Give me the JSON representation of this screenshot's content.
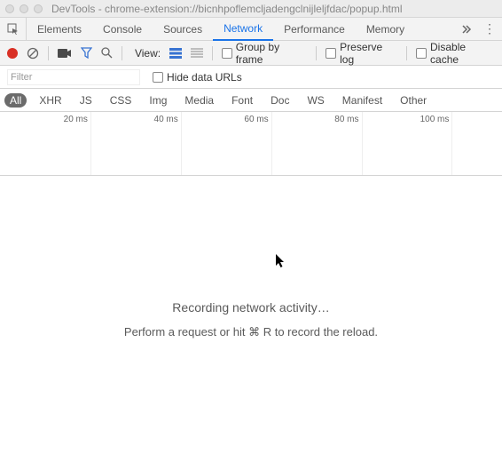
{
  "window": {
    "title": "DevTools - chrome-extension://bicnhpoflemcljadengclnijleljfdac/popup.html"
  },
  "tabs": {
    "items": [
      {
        "label": "Elements"
      },
      {
        "label": "Console"
      },
      {
        "label": "Sources"
      },
      {
        "label": "Network"
      },
      {
        "label": "Performance"
      },
      {
        "label": "Memory"
      }
    ],
    "active_index": 3
  },
  "toolbar": {
    "view_label": "View:",
    "group_by_frame": "Group by frame",
    "preserve_log": "Preserve log",
    "disable_cache": "Disable cache"
  },
  "filterbar": {
    "placeholder": "Filter",
    "hide_data_urls": "Hide data URLs"
  },
  "types": {
    "items": [
      "All",
      "XHR",
      "JS",
      "CSS",
      "Img",
      "Media",
      "Font",
      "Doc",
      "WS",
      "Manifest",
      "Other"
    ],
    "active_index": 0
  },
  "timeline": {
    "ticks": [
      "20 ms",
      "40 ms",
      "60 ms",
      "80 ms",
      "100 ms"
    ],
    "positions_pct": [
      18,
      36,
      54,
      72,
      90
    ]
  },
  "messages": {
    "recording": "Recording network activity…",
    "hint_full": "Perform a request or hit ⌘ R to record the reload."
  }
}
